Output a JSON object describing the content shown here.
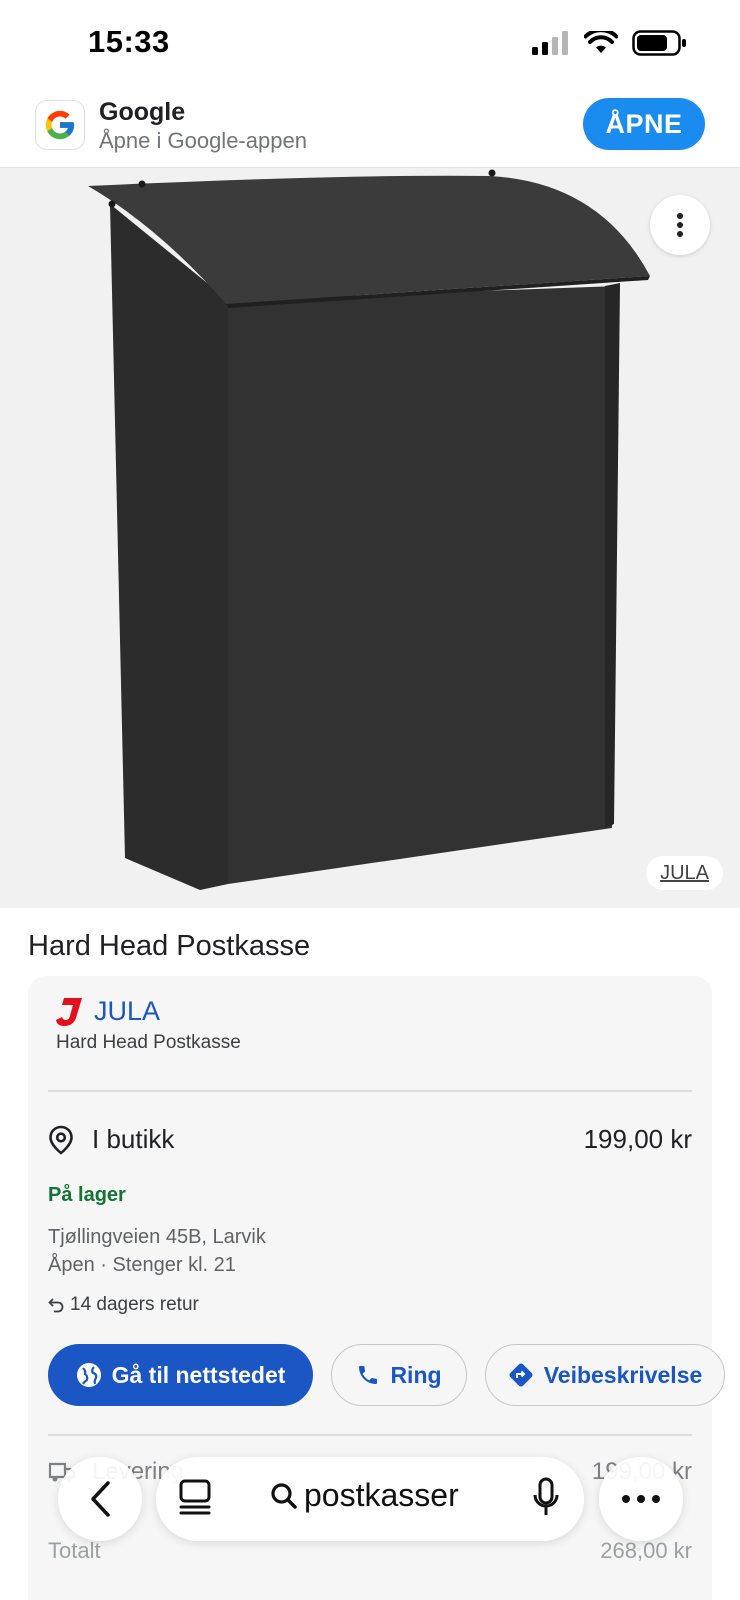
{
  "status_bar": {
    "time": "15:33"
  },
  "banner": {
    "title": "Google",
    "subtitle": "Åpne i Google-appen",
    "open_label": "ÅPNE"
  },
  "image": {
    "source_label": "JULA"
  },
  "product": {
    "title": "Hard Head Postkasse"
  },
  "offer": {
    "merchant": "JULA",
    "merchant_product": "Hard Head Postkasse",
    "store_label": "I butikk",
    "store_price": "199,00 kr",
    "stock": "På lager",
    "address": "Tjøllingveien 45B, Larvik",
    "hours": "Åpen · Stenger kl. 21",
    "return_policy": "14 dagers retur",
    "actions": {
      "website": "Gå til nettstedet",
      "call": "Ring",
      "directions": "Veibeskrivelse"
    },
    "delivery_label": "Levering",
    "delivery_price": "199,00 kr",
    "total_label": "Totalt",
    "total_price": "268,00 kr"
  },
  "toolbar": {
    "search_query": "postkasser"
  },
  "colors": {
    "accent": "#1a56c4",
    "banner_button": "#1a8cf0",
    "in_stock": "#137333",
    "jula_red": "#e3101b"
  }
}
